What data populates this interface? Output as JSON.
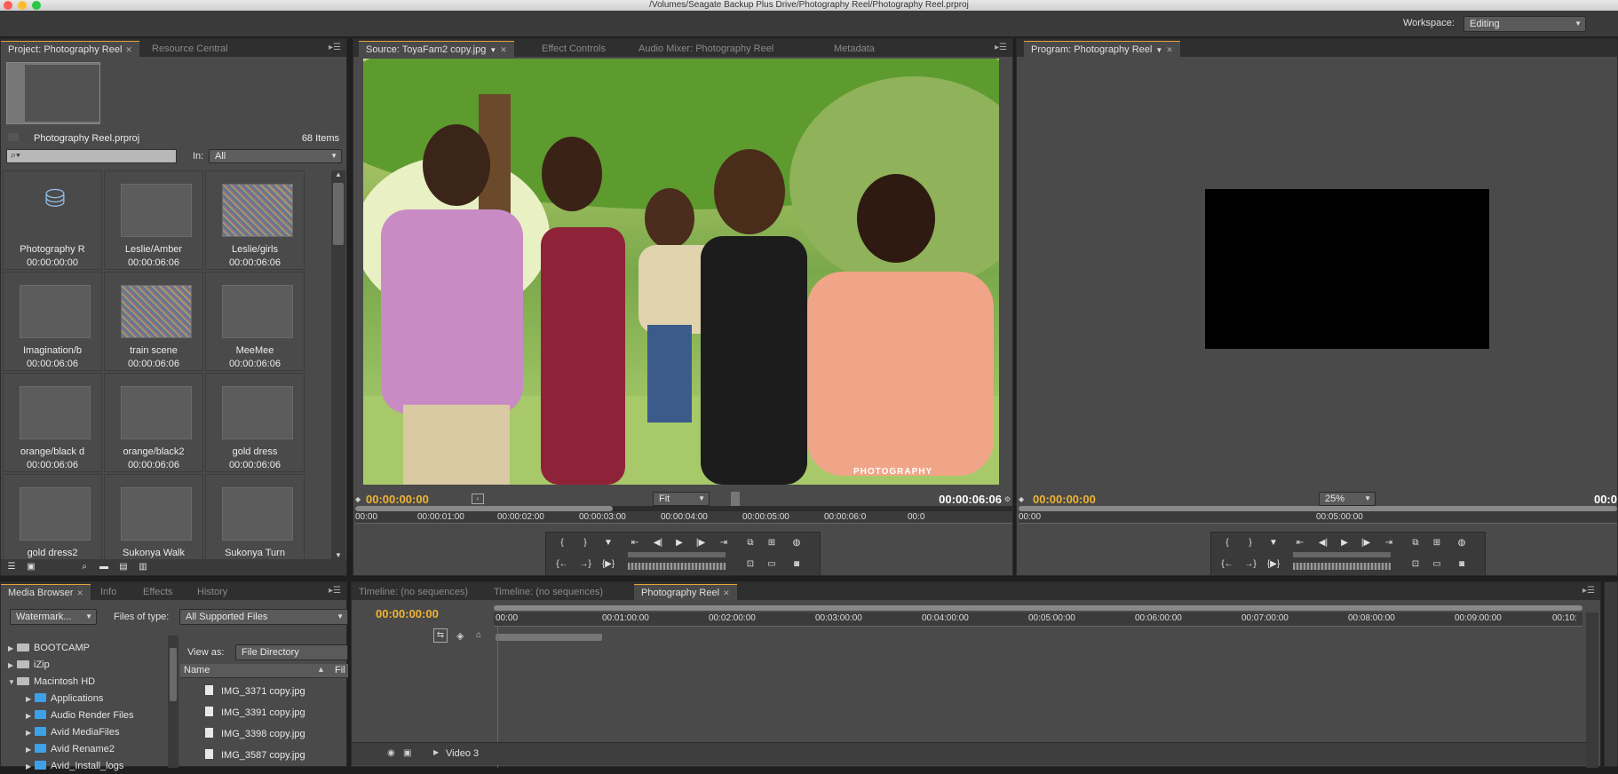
{
  "window": {
    "title": "/Volumes/Seagate Backup Plus Drive/Photography Reel/Photography Reel.prproj"
  },
  "workspace": {
    "label": "Workspace:",
    "value": "Editing"
  },
  "project_panel": {
    "tabs": [
      "Project: Photography Reel",
      "Resource Central"
    ],
    "project_file": "Photography Reel.prproj",
    "item_count": "68 Items",
    "in_label": "In:",
    "in_value": "All",
    "items": [
      {
        "name": "Photography R",
        "duration": "00:00:00:00"
      },
      {
        "name": "Leslie/Amber",
        "duration": "00:00:06:06"
      },
      {
        "name": "Leslie/girls",
        "duration": "00:00:06:06"
      },
      {
        "name": "Imagination/b",
        "duration": "00:00:06:06"
      },
      {
        "name": "train scene",
        "duration": "00:00:06:06"
      },
      {
        "name": "MeeMee",
        "duration": "00:00:06:06"
      },
      {
        "name": "orange/black d",
        "duration": "00:00:06:06"
      },
      {
        "name": "orange/black2",
        "duration": "00:00:06:06"
      },
      {
        "name": "gold dress",
        "duration": "00:00:06:06"
      },
      {
        "name": "gold dress2",
        "duration": ""
      },
      {
        "name": "Sukonya Walk",
        "duration": ""
      },
      {
        "name": "Sukonya Turn",
        "duration": ""
      }
    ]
  },
  "source_monitor": {
    "tabs": [
      "Source: ToyaFam2 copy.jpg",
      "Effect Controls",
      "Audio Mixer: Photography Reel",
      "Metadata"
    ],
    "current_tc": "00:00:00:00",
    "duration_tc": "00:00:06:06",
    "zoom": "Fit",
    "watermark_text": "PHOTOGRAPHY",
    "ruler": [
      "00:00",
      "00:00:01:00",
      "00:00:02:00",
      "00:00:03:00",
      "00:00:04:00",
      "00:00:05:00",
      "00:00:06:0",
      "00:0"
    ]
  },
  "program_monitor": {
    "tabs": [
      "Program: Photography Reel"
    ],
    "current_tc": "00:00:00:00",
    "duration_tc": "00:0",
    "zoom": "25%",
    "ruler": [
      "00:00",
      "00:05:00:00"
    ]
  },
  "media_browser": {
    "tabs": [
      "Media Browser",
      "Info",
      "Effects",
      "History"
    ],
    "location": "Watermark...",
    "files_of_type_label": "Files of type:",
    "files_of_type": "All Supported Files",
    "view_as_label": "View as:",
    "view_as": "File Directory",
    "col_name": "Name",
    "col_file": "Fil",
    "tree": [
      {
        "label": "BOOTCAMP",
        "kind": "drive",
        "depth": 0,
        "open": false
      },
      {
        "label": "iZip",
        "kind": "drive",
        "depth": 0,
        "open": false
      },
      {
        "label": "Macintosh HD",
        "kind": "drive",
        "depth": 0,
        "open": true
      },
      {
        "label": "Applications",
        "kind": "folder",
        "depth": 1,
        "open": false
      },
      {
        "label": "Audio Render Files",
        "kind": "folder",
        "depth": 1,
        "open": false
      },
      {
        "label": "Avid MediaFiles",
        "kind": "folder",
        "depth": 1,
        "open": false
      },
      {
        "label": "Avid Rename2",
        "kind": "folder",
        "depth": 1,
        "open": false
      },
      {
        "label": "Avid_Install_logs",
        "kind": "folder",
        "depth": 1,
        "open": false
      }
    ],
    "files": [
      "IMG_3371 copy.jpg",
      "IMG_3391 copy.jpg",
      "IMG_3398 copy.jpg",
      "IMG_3587 copy.jpg"
    ]
  },
  "timeline": {
    "tabs": [
      "Timeline: (no sequences)",
      "Timeline: (no sequences)",
      "Photography Reel"
    ],
    "current_tc": "00:00:00:00",
    "ruler": [
      "00:00",
      "00:01:00:00",
      "00:02:00:00",
      "00:03:00:00",
      "00:04:00:00",
      "00:05:00:00",
      "00:06:00:00",
      "00:07:00:00",
      "00:08:00:00",
      "00:09:00:00",
      "00:10:"
    ],
    "track": "Video 3"
  },
  "colors": {
    "timecode": "#f0b433",
    "folder": "#3ea1e8",
    "playhead": "#d03a3a"
  }
}
